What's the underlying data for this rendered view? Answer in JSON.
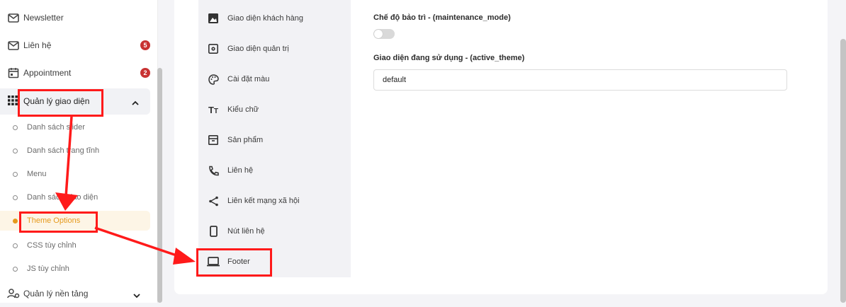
{
  "sidebar": {
    "items": [
      {
        "label": "Newsletter",
        "icon": "mail-icon"
      },
      {
        "label": "Liên hệ",
        "icon": "mail-icon",
        "badge": "5"
      },
      {
        "label": "Appointment",
        "icon": "calendar-icon",
        "badge": "2"
      }
    ],
    "group": {
      "label": "Quản lý giao diện",
      "icon": "grid-icon"
    },
    "sub_items": [
      "Danh sách slider",
      "Danh sách trang tĩnh",
      "Menu",
      "Danh sách giao diện",
      "Theme Options",
      "CSS tùy chỉnh",
      "JS tùy chỉnh"
    ],
    "active_sub": "Theme Options",
    "bottom_item": {
      "label": "Quản lý nền tảng",
      "icon": "users-gear-icon"
    }
  },
  "tabs": [
    {
      "label": "Giao diện khách hàng",
      "icon": "image-icon"
    },
    {
      "label": "Giao diện quản trị",
      "icon": "gear-box-icon"
    },
    {
      "label": "Cài đặt màu",
      "icon": "palette-icon"
    },
    {
      "label": "Kiểu chữ",
      "icon": "text-icon"
    },
    {
      "label": "Sản phẩm",
      "icon": "archive-icon"
    },
    {
      "label": "Liên hệ",
      "icon": "phone-icon"
    },
    {
      "label": "Liên kết mạng xã hội",
      "icon": "share-icon"
    },
    {
      "label": "Nút liên hệ",
      "icon": "mobile-icon"
    },
    {
      "label": "Footer",
      "icon": "laptop-icon"
    }
  ],
  "form": {
    "maintenance_label": "Chế độ bảo trì - (maintenance_mode)",
    "maintenance_on": false,
    "theme_label": "Giao diện đang sử dụng - (active_theme)",
    "theme_value": "default"
  },
  "colors": {
    "accent": "#e59a1c",
    "badge": "#c83232",
    "annotation": "#ff1a1a"
  }
}
